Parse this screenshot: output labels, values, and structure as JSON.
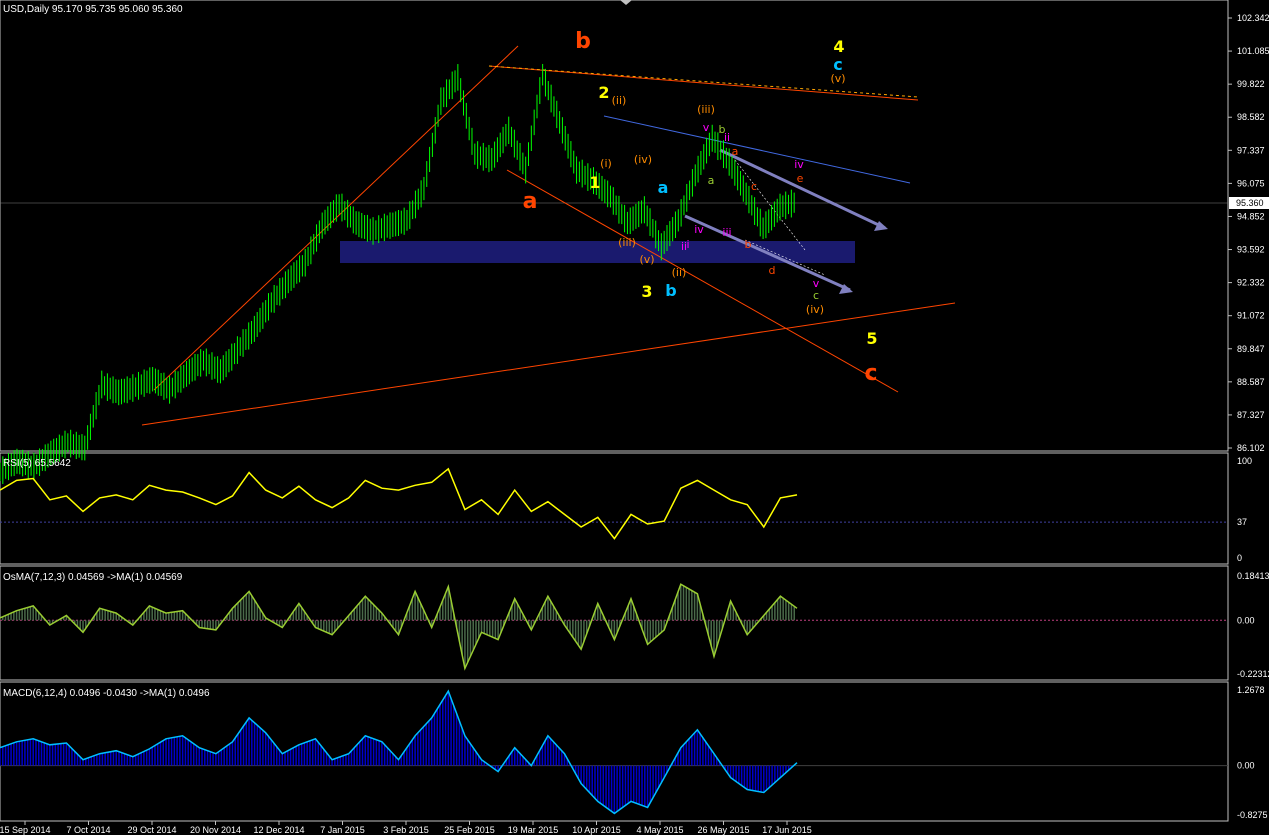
{
  "header": {
    "symbol_line": "USD,Daily  95.170 95.735 95.060 95.360",
    "rsi_line": "RSI(5) 65.5642",
    "osma_line": "OsMA(7,12,3) 0.04569  ->MA(1) 0.04569",
    "macd_line": "MACD(6,12,4) 0.0496 -0.0430  ->MA(1) 0.0496"
  },
  "colors": {
    "background": "#000000",
    "candles": "#00ff00",
    "rsi": "#ffff00",
    "osma": "#9acd32",
    "macd": "#0000cc",
    "macd_line": "#00bfff",
    "rect": "#1a1a6e",
    "grid": "#c0c0c0"
  },
  "chart_data": [
    {
      "type": "line",
      "name": "price",
      "title": "USD,Daily",
      "last_price": "95.360",
      "ylim": [
        86.102,
        102.342
      ],
      "y_ticks": [
        "102.342",
        "101.085",
        "99.822",
        "98.582",
        "97.337",
        "96.075",
        "94.852",
        "93.592",
        "92.332",
        "91.072",
        "89.847",
        "88.587",
        "87.327",
        "86.102"
      ],
      "x_ticks": [
        "15 Sep 2014",
        "7 Oct 2014",
        "29 Oct 2014",
        "20 Nov 2014",
        "12 Dec 2014",
        "7 Jan 2015",
        "3 Feb 2015",
        "25 Feb 2015",
        "19 Mar 2015",
        "10 Apr 2015",
        "4 May 2015",
        "26 May 2015",
        "17 Jun 2015"
      ],
      "x": [
        0,
        6,
        12,
        18,
        24,
        30,
        36,
        42,
        48,
        54,
        60,
        66,
        72,
        78,
        84,
        90,
        96,
        102,
        108,
        114,
        120,
        126,
        132,
        138,
        144,
        150,
        156,
        162,
        168,
        174,
        180,
        186,
        192,
        198,
        204,
        210,
        216,
        222,
        228,
        234,
        240,
        246,
        252,
        258,
        264,
        270,
        276,
        282
      ],
      "close": [
        85.2,
        85.6,
        85.4,
        85.9,
        86.3,
        86.1,
        88.5,
        88.2,
        88.4,
        88.7,
        88.3,
        88.9,
        89.4,
        89.0,
        89.8,
        90.6,
        91.6,
        92.4,
        93.1,
        94.5,
        95.3,
        94.6,
        94.3,
        94.5,
        94.7,
        95.9,
        99.2,
        100.1,
        97.2,
        97.0,
        98.1,
        96.6,
        100.2,
        98.4,
        96.6,
        96.2,
        95.6,
        94.6,
        95.1,
        93.7,
        94.7,
        96.4,
        97.8,
        96.9,
        95.7,
        94.4,
        95.2,
        95.4
      ],
      "annotations": [
        {
          "text": "b",
          "color": "#ff4500",
          "size": "large"
        },
        {
          "text": "4",
          "color": "#ffff00",
          "size": "medium"
        },
        {
          "text": "c",
          "color": "#00bfff",
          "size": "medium"
        },
        {
          "text": "(v)",
          "color": "#ff8c00",
          "size": "small"
        },
        {
          "text": "2",
          "color": "#ffff00",
          "size": "medium"
        },
        {
          "text": "(ii)",
          "color": "#ff8c00",
          "size": "small"
        },
        {
          "text": "(iii)",
          "color": "#ff8c00",
          "size": "small"
        },
        {
          "text": "v",
          "color": "#ff00ff",
          "size": "small"
        },
        {
          "text": "b",
          "color": "#9acd32",
          "size": "small"
        },
        {
          "text": "ii",
          "color": "#ff00ff",
          "size": "small"
        },
        {
          "text": "a",
          "color": "#ff4500",
          "size": "small"
        },
        {
          "text": "(i)",
          "color": "#ff8c00",
          "size": "small"
        },
        {
          "text": "(iv)",
          "color": "#ff8c00",
          "size": "small"
        },
        {
          "text": "1",
          "color": "#ffff00",
          "size": "medium"
        },
        {
          "text": "a",
          "color": "#00bfff",
          "size": "medium"
        },
        {
          "text": "a",
          "color": "#9acd32",
          "size": "small"
        },
        {
          "text": "c",
          "color": "#ff4500",
          "size": "small"
        },
        {
          "text": "iv",
          "color": "#ff00ff",
          "size": "small"
        },
        {
          "text": "e",
          "color": "#ff4500",
          "size": "small"
        },
        {
          "text": "a",
          "color": "#ff4500",
          "size": "large"
        },
        {
          "text": "iv",
          "color": "#ff00ff",
          "size": "small"
        },
        {
          "text": "iii",
          "color": "#ff00ff",
          "size": "small"
        },
        {
          "text": "i",
          "color": "#ff00ff",
          "size": "small"
        },
        {
          "text": "(iii)",
          "color": "#ff8c00",
          "size": "small"
        },
        {
          "text": "ii",
          "color": "#ff00ff",
          "size": "small"
        },
        {
          "text": "b",
          "color": "#ff4500",
          "size": "small"
        },
        {
          "text": "(v)",
          "color": "#ff8c00",
          "size": "small"
        },
        {
          "text": "(ii)",
          "color": "#ff8c00",
          "size": "small"
        },
        {
          "text": "d",
          "color": "#ff4500",
          "size": "small"
        },
        {
          "text": "v",
          "color": "#ff00ff",
          "size": "small"
        },
        {
          "text": "3",
          "color": "#ffff00",
          "size": "medium"
        },
        {
          "text": "b",
          "color": "#00bfff",
          "size": "medium"
        },
        {
          "text": "c",
          "color": "#9acd32",
          "size": "small"
        },
        {
          "text": "(iv)",
          "color": "#ff8c00",
          "size": "small"
        },
        {
          "text": "5",
          "color": "#ffff00",
          "size": "medium"
        },
        {
          "text": "c",
          "color": "#ff4500",
          "size": "large"
        }
      ]
    },
    {
      "type": "line",
      "name": "RSI(5)",
      "ylim": [
        0,
        100
      ],
      "y_ticks": [
        "100",
        "37",
        "0"
      ],
      "levels": [
        37
      ],
      "values": [
        70,
        80,
        82,
        60,
        64,
        48,
        62,
        65,
        60,
        75,
        70,
        68,
        62,
        55,
        64,
        88,
        70,
        62,
        74,
        60,
        52,
        62,
        80,
        72,
        70,
        75,
        78,
        92,
        50,
        60,
        45,
        70,
        48,
        58,
        45,
        32,
        42,
        20,
        45,
        35,
        38,
        72,
        80,
        70,
        60,
        55,
        32,
        62,
        65
      ]
    },
    {
      "type": "bar",
      "name": "OsMA(7,12,3)",
      "ylim": [
        -0.22312,
        0.18413
      ],
      "y_ticks": [
        "0.18413",
        "0.00",
        "-0.22312"
      ],
      "values": [
        0.01,
        0.04,
        0.06,
        -0.02,
        0.02,
        -0.05,
        0.05,
        0.03,
        -0.02,
        0.06,
        0.03,
        0.04,
        -0.03,
        -0.04,
        0.05,
        0.12,
        0.01,
        -0.03,
        0.07,
        -0.03,
        -0.06,
        0.02,
        0.1,
        0.03,
        -0.06,
        0.12,
        -0.03,
        0.14,
        -0.2,
        -0.05,
        -0.08,
        0.09,
        -0.04,
        0.1,
        -0.02,
        -0.12,
        0.07,
        -0.08,
        0.09,
        -0.1,
        -0.04,
        0.15,
        0.11,
        -0.15,
        0.08,
        -0.06,
        0.02,
        0.1,
        0.05
      ]
    },
    {
      "type": "area",
      "name": "MACD(6,12,4)",
      "ylim": [
        -0.8275,
        1.2678
      ],
      "y_ticks": [
        "1.2678",
        "0.00",
        "-0.8275"
      ],
      "values": [
        0.3,
        0.4,
        0.45,
        0.35,
        0.38,
        0.1,
        0.2,
        0.25,
        0.15,
        0.28,
        0.45,
        0.5,
        0.3,
        0.2,
        0.4,
        0.8,
        0.55,
        0.2,
        0.35,
        0.45,
        0.1,
        0.2,
        0.5,
        0.4,
        0.1,
        0.5,
        0.8,
        1.25,
        0.5,
        0.1,
        -0.1,
        0.3,
        0.0,
        0.5,
        0.2,
        -0.3,
        -0.6,
        -0.8,
        -0.6,
        -0.7,
        -0.2,
        0.3,
        0.6,
        0.2,
        -0.2,
        -0.4,
        -0.45,
        -0.2,
        0.05
      ]
    }
  ]
}
